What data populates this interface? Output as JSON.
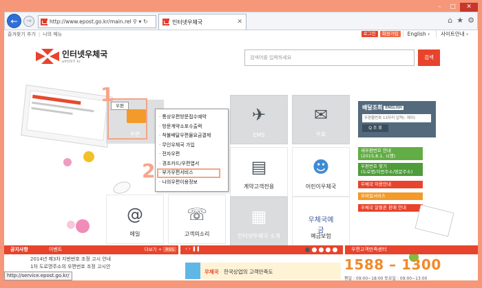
{
  "browser": {
    "url": "http://www.epost.go.kr/main.retrieve",
    "tab_title": "인터넷우체국",
    "status_url": "http://service.epost.go.kr/"
  },
  "topbar": {
    "favorites": "즐겨찾기 추가",
    "my_menu": "나의 메뉴",
    "login": "로그인",
    "signup": "회원가입",
    "english": "English ›",
    "sitemap": "사이트안내 ›"
  },
  "header": {
    "logo_korean": "인터넷우체국",
    "logo_english": "ePOST kr",
    "search_placeholder": "검색어를 입력하세요",
    "search_button": "검색"
  },
  "tiles": {
    "post": "우편",
    "ems": "EMS",
    "stamp": "우표",
    "contract": "계약고객전용",
    "kids": "어린이우체국",
    "mail": "메일",
    "voice": "고객의소리",
    "intro": "인터넷우체국 소개",
    "savings": "예금보험"
  },
  "callouts": {
    "num1": "1",
    "num2": "2",
    "post_tooltip": "우편"
  },
  "post_menu": [
    "통상우편방문접수예약",
    "방문계약소포수출력",
    "착불배달우편물요금결제",
    "무인우체국 가입",
    "전자우편",
    "경조카드/우편엽서",
    "부가우편서비스",
    "나의우편이용정보"
  ],
  "delivery": {
    "title": "배달조회",
    "badge": "ENGLISH",
    "input_placeholder": "우편물번호 13자리 입력(- 제외)",
    "button": "Q 조 회"
  },
  "side_buttons": {
    "new_address_line1": "새우편번호 안내",
    "new_address_line2": "(2015.8.1. 시행)",
    "find_postcode_line1": "우편번호 찾기",
    "find_postcode_line2": "(도로명/지번주소/영문주소)",
    "post_guide": "우체국 이용안내",
    "mobile": "모바일서비스",
    "stamp_sale": "우체국 알뜰폰 판매 안내"
  },
  "notices": {
    "tab_notice": "공지사항",
    "tab_event": "이벤트",
    "more": "더보기 +",
    "rss": "RSS",
    "items": [
      "2014년 제3차 지번번호 조정 고시 안내",
      "1차 도로명주소의 우편번호 조정 고시안"
    ]
  },
  "banner": {
    "controls": "‹ ›  ❚❚",
    "brand": "우체국",
    "text": "한국상업의 고객만족도"
  },
  "customer_center": {
    "title": "우편고객만족센터",
    "phone": "1588 – 1300",
    "hours": "평일 : 09:00~18:00   토요일 : 09:00~13:00"
  },
  "colors": {
    "brand_red": "#e8432c",
    "delivery_slate": "#546a7c",
    "highlight_peach": "#f2a487",
    "green": "#63ad46",
    "orange": "#f29a2a"
  }
}
